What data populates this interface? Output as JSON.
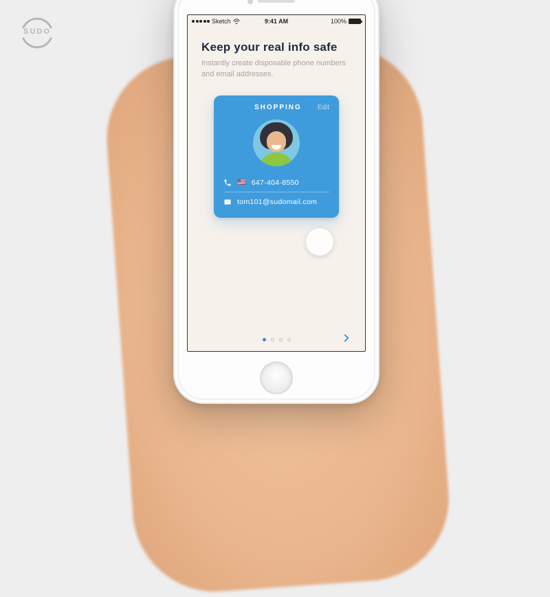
{
  "brand": {
    "logo_text": "SUDO"
  },
  "status_bar": {
    "carrier": "Sketch",
    "time": "9:41 AM",
    "battery_pct": "100%"
  },
  "onboarding": {
    "title": "Keep your real info safe",
    "subtitle": "Instantly create disposable phone numbers and email addresses.",
    "pages_total": 4,
    "active_page_index": 0
  },
  "card": {
    "label": "SHOPPING",
    "edit_label": "Edit",
    "phone_flag": "🇺🇸",
    "phone": "647-404-8550",
    "email": "tom101@sudomail.com"
  }
}
